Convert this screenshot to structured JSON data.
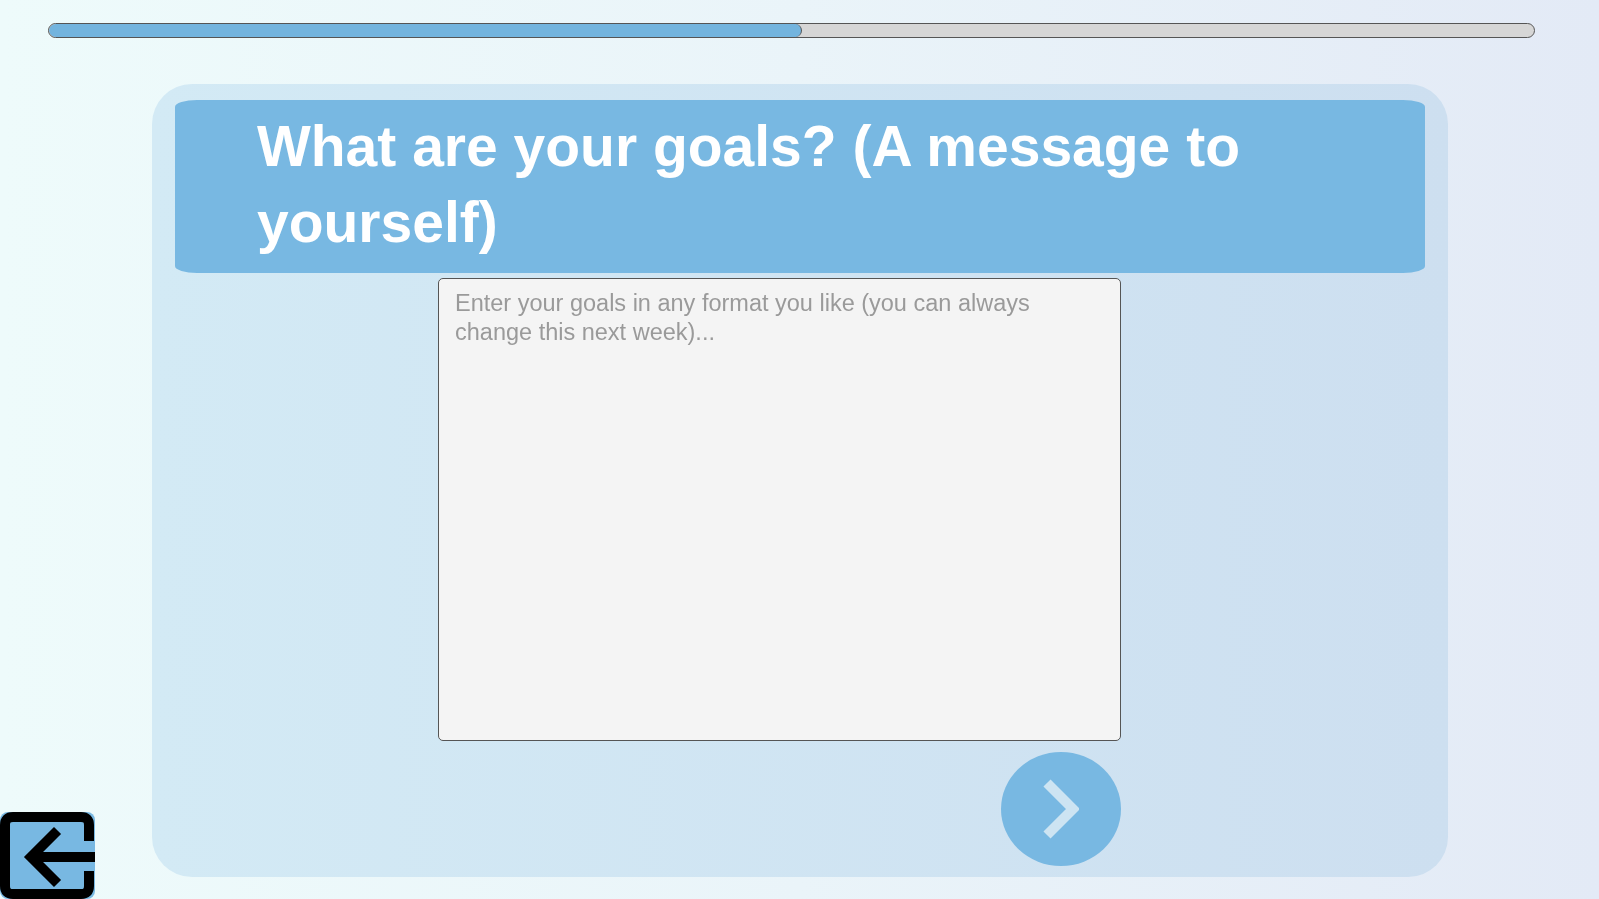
{
  "progress": {
    "level": 0.507
  },
  "question": {
    "title": "What are your goals? (A message to yourself)"
  },
  "answer": {
    "placeholder": "Enter your goals in any format you like (you can always change this next week)..."
  }
}
